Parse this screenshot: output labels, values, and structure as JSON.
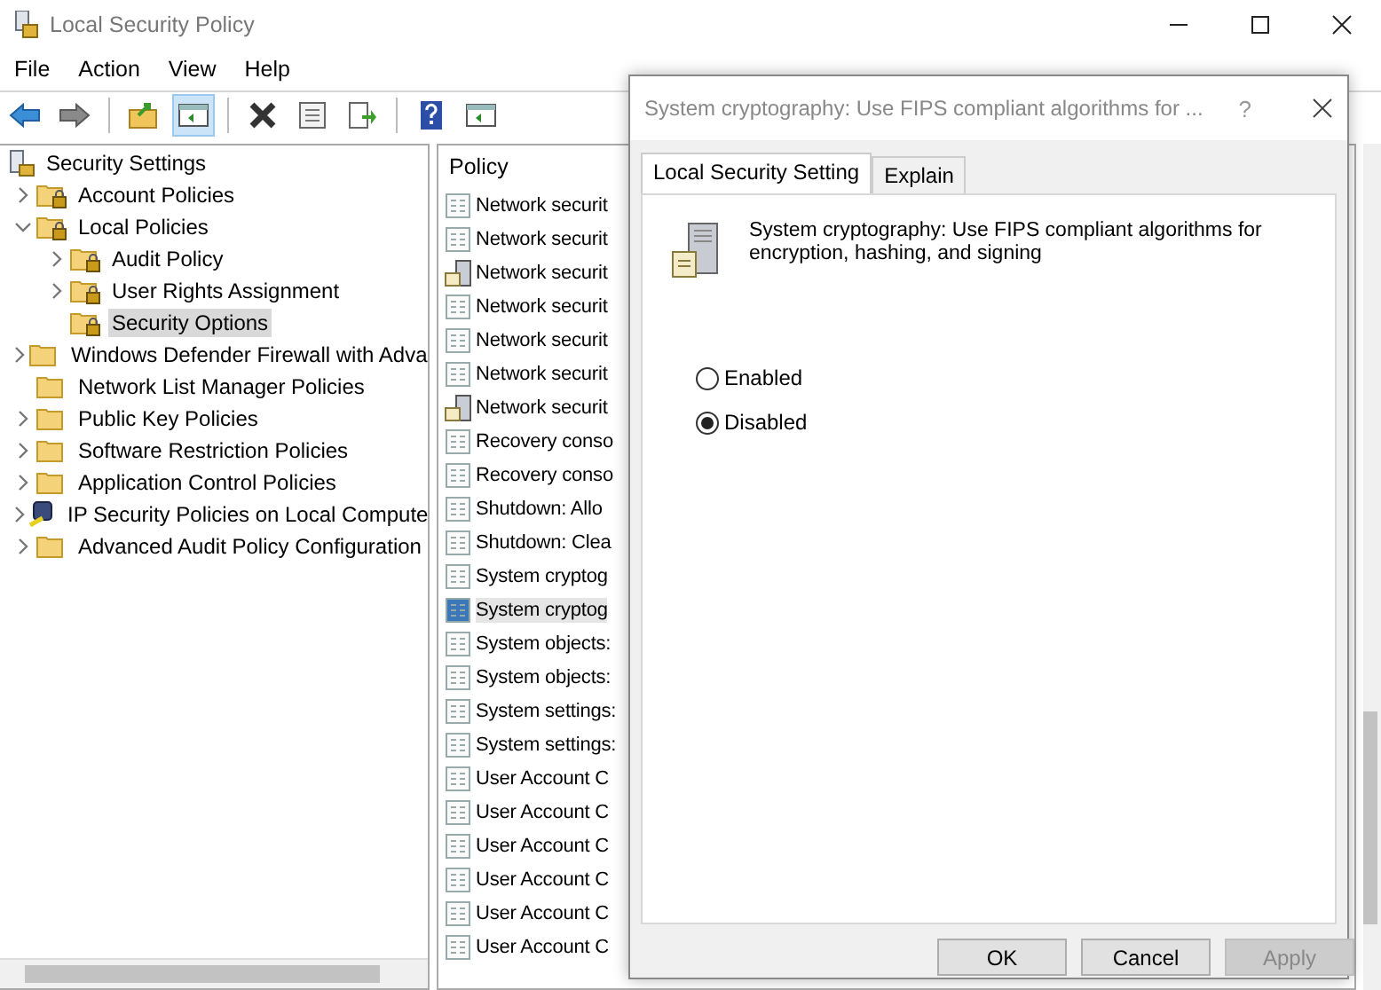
{
  "window": {
    "title": "Local Security Policy"
  },
  "menu": [
    "File",
    "Action",
    "View",
    "Help"
  ],
  "toolbar": [
    {
      "kind": "back",
      "pressed": false
    },
    {
      "kind": "forward",
      "pressed": false
    },
    {
      "kind": "sep"
    },
    {
      "kind": "up",
      "pressed": false
    },
    {
      "kind": "pane",
      "pressed": true
    },
    {
      "kind": "sep"
    },
    {
      "kind": "delete",
      "pressed": false
    },
    {
      "kind": "properties",
      "pressed": false
    },
    {
      "kind": "export",
      "pressed": false
    },
    {
      "kind": "sep"
    },
    {
      "kind": "help",
      "pressed": false
    },
    {
      "kind": "pane2",
      "pressed": false
    }
  ],
  "tree": {
    "label": "Security Settings",
    "children": [
      {
        "label": "Account Policies",
        "kind": "locked",
        "expandable": true,
        "expanded": false,
        "selected": false
      },
      {
        "label": "Local Policies",
        "kind": "locked",
        "expandable": true,
        "expanded": true,
        "selected": false,
        "children": [
          {
            "label": "Audit Policy",
            "kind": "locked",
            "expandable": true,
            "expanded": false,
            "selected": false
          },
          {
            "label": "User Rights Assignment",
            "kind": "locked",
            "expandable": true,
            "expanded": false,
            "selected": false
          },
          {
            "label": "Security Options",
            "kind": "locked",
            "expandable": false,
            "expanded": false,
            "selected": true
          }
        ]
      },
      {
        "label": "Windows Defender Firewall with Adva",
        "kind": "folder",
        "expandable": true,
        "expanded": false,
        "selected": false
      },
      {
        "label": "Network List Manager Policies",
        "kind": "folder",
        "expandable": false,
        "expanded": false,
        "selected": false
      },
      {
        "label": "Public Key Policies",
        "kind": "folder",
        "expandable": true,
        "expanded": false,
        "selected": false
      },
      {
        "label": "Software Restriction Policies",
        "kind": "folder",
        "expandable": true,
        "expanded": false,
        "selected": false
      },
      {
        "label": "Application Control Policies",
        "kind": "folder",
        "expandable": true,
        "expanded": false,
        "selected": false
      },
      {
        "label": "IP Security Policies on Local Compute",
        "kind": "ip",
        "expandable": true,
        "expanded": false,
        "selected": false
      },
      {
        "label": "Advanced Audit Policy Configuration",
        "kind": "folder",
        "expandable": true,
        "expanded": false,
        "selected": false
      }
    ]
  },
  "policy_list": {
    "column": "Policy",
    "rows": [
      {
        "label": "Network securit",
        "kind": "policy",
        "selected": false
      },
      {
        "label": "Network securit",
        "kind": "policy",
        "selected": false
      },
      {
        "label": "Network securit",
        "kind": "server",
        "selected": false
      },
      {
        "label": "Network securit",
        "kind": "policy",
        "selected": false
      },
      {
        "label": "Network securit",
        "kind": "policy",
        "selected": false
      },
      {
        "label": "Network securit",
        "kind": "policy",
        "selected": false
      },
      {
        "label": "Network securit",
        "kind": "server",
        "selected": false
      },
      {
        "label": "Recovery conso",
        "kind": "policy",
        "selected": false
      },
      {
        "label": "Recovery conso",
        "kind": "policy",
        "selected": false
      },
      {
        "label": "Shutdown: Allo",
        "kind": "policy",
        "selected": false
      },
      {
        "label": "Shutdown: Clea",
        "kind": "policy",
        "selected": false
      },
      {
        "label": "System cryptog",
        "kind": "policy",
        "selected": false
      },
      {
        "label": "System cryptog",
        "kind": "policy",
        "selected": true
      },
      {
        "label": "System objects:",
        "kind": "policy",
        "selected": false
      },
      {
        "label": "System objects:",
        "kind": "policy",
        "selected": false
      },
      {
        "label": "System settings:",
        "kind": "policy",
        "selected": false
      },
      {
        "label": "System settings:",
        "kind": "policy",
        "selected": false
      },
      {
        "label": "User Account C",
        "kind": "policy",
        "selected": false
      },
      {
        "label": "User Account C",
        "kind": "policy",
        "selected": false
      },
      {
        "label": "User Account C",
        "kind": "policy",
        "selected": false
      },
      {
        "label": "User Account C",
        "kind": "policy",
        "selected": false
      },
      {
        "label": "User Account C",
        "kind": "policy",
        "selected": false
      },
      {
        "label": "User Account C",
        "kind": "policy",
        "selected": false
      }
    ]
  },
  "dialog": {
    "title": "System cryptography: Use FIPS compliant algorithms for ...",
    "help": "?",
    "tabs": [
      {
        "label": "Local Security Setting",
        "selected": true
      },
      {
        "label": "Explain",
        "selected": false
      }
    ],
    "description": "System cryptography: Use FIPS compliant algorithms for encryption, hashing, and signing",
    "options": [
      {
        "label": "Enabled",
        "selected": false
      },
      {
        "label": "Disabled",
        "selected": true
      }
    ],
    "buttons": [
      {
        "label": "OK",
        "disabled": false
      },
      {
        "label": "Cancel",
        "disabled": false
      },
      {
        "label": "Apply",
        "disabled": true
      }
    ]
  }
}
